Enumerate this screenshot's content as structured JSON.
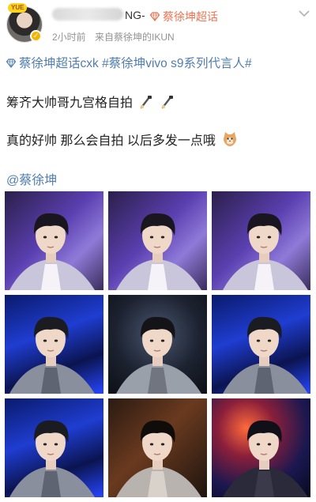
{
  "post": {
    "user_badge": "YUE",
    "username_suffix": "NG-",
    "super_topic": "蔡徐坤超话",
    "time": "2小时前",
    "source": "来自蔡徐坤的IKUN"
  },
  "body": {
    "topic_1": "蔡徐坤超话cxk",
    "topic_2": "#蔡徐坤vivo s9系列代言人#",
    "line_2": "筹齐大帅哥九宫格自拍",
    "line_3": "真的好帅 那么会自拍 以后多发一点哦",
    "mention": "@蔡徐坤"
  },
  "icons": {
    "super_topic": "diamond-icon",
    "more": "chevron-down-icon",
    "selfie_emoji": "selfie-stick-emoji",
    "cat_emoji": "cat-face-emoji"
  },
  "colors": {
    "link": "#507daf",
    "super_topic": "#eb7350",
    "meta": "#939393"
  },
  "photos": [
    {
      "name": "photo-1",
      "scene": "purple-studio"
    },
    {
      "name": "photo-2",
      "scene": "purple-studio"
    },
    {
      "name": "photo-3",
      "scene": "purple-studio"
    },
    {
      "name": "photo-4",
      "scene": "blue-neon"
    },
    {
      "name": "photo-5",
      "scene": "tunnel-lights"
    },
    {
      "name": "photo-6",
      "scene": "blue-neon"
    },
    {
      "name": "photo-7",
      "scene": "blue-neon"
    },
    {
      "name": "photo-8",
      "scene": "warm-dark"
    },
    {
      "name": "photo-9",
      "scene": "stage-lights"
    }
  ]
}
